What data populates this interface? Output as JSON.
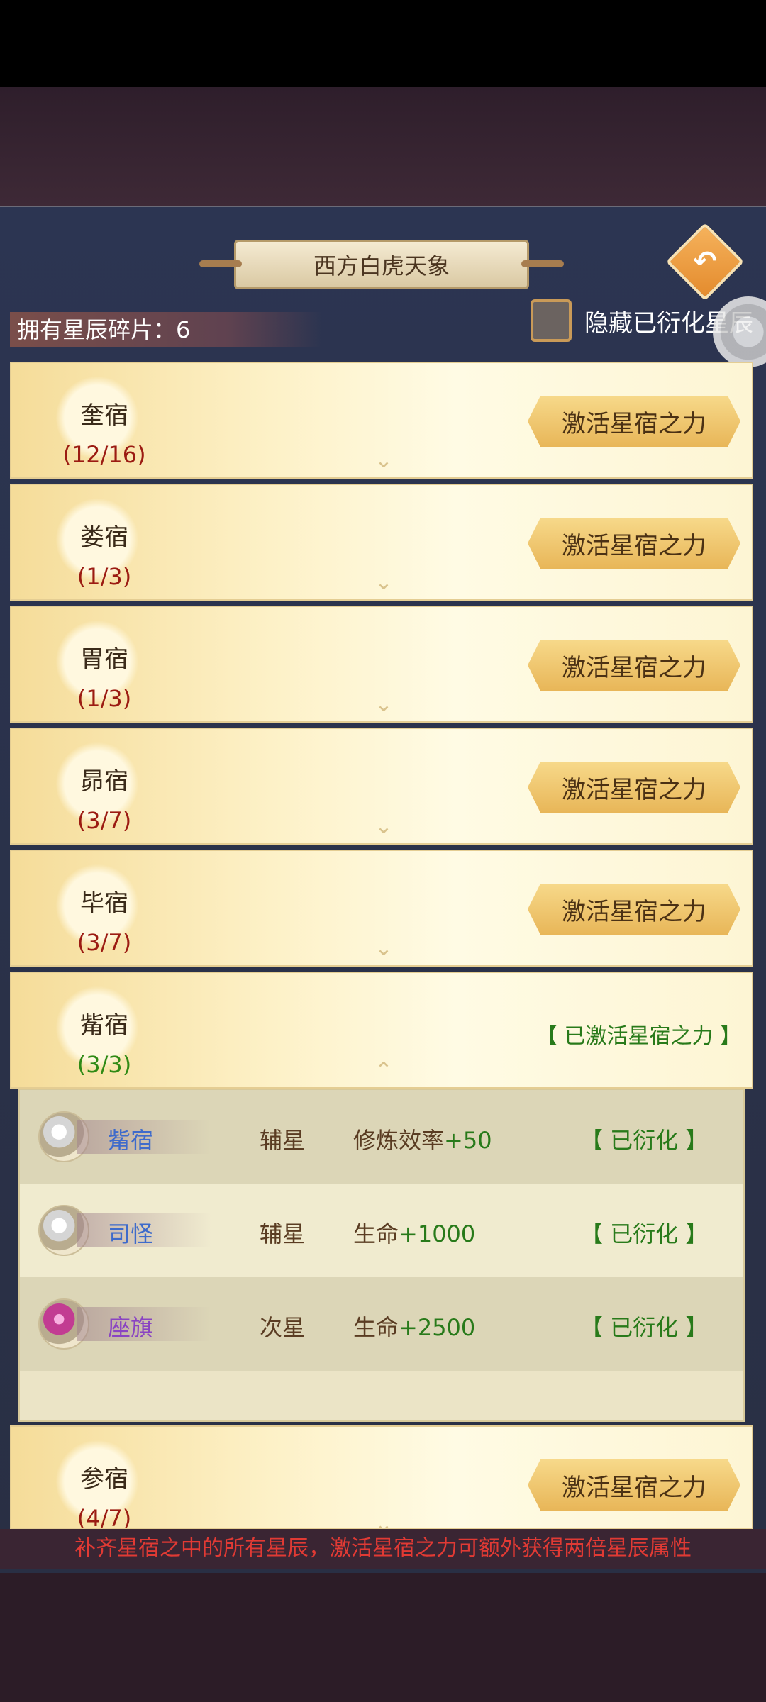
{
  "header": {
    "title": "西方白虎天象",
    "back_icon": "back-arrow-icon"
  },
  "shards": {
    "label": "拥有星辰碎片：6"
  },
  "hide_option": {
    "label": "隐藏已衍化星辰",
    "checked": false
  },
  "rows": [
    {
      "name": "奎宿",
      "progress": "(12/16)",
      "button": "激活星宿之力"
    },
    {
      "name": "娄宿",
      "progress": "(1/3)",
      "button": "激活星宿之力"
    },
    {
      "name": "胃宿",
      "progress": "(1/3)",
      "button": "激活星宿之力"
    },
    {
      "name": "昴宿",
      "progress": "(3/7)",
      "button": "激活星宿之力"
    },
    {
      "name": "毕宿",
      "progress": "(3/7)",
      "button": "激活星宿之力"
    },
    {
      "name": "觜宿",
      "progress": "(3/3)",
      "status": "【 已激活星宿之力 】"
    },
    {
      "name": "参宿",
      "progress": "(4/7)",
      "button": "激活星宿之力"
    }
  ],
  "stars": [
    {
      "name": "觜宿",
      "type": "辅星",
      "effect_label": "修炼效率",
      "effect_value": "+50",
      "status": "【 已衍化 】"
    },
    {
      "name": "司怪",
      "type": "辅星",
      "effect_label": "生命",
      "effect_value": "+1000",
      "status": "【 已衍化 】"
    },
    {
      "name": "座旗",
      "type": "次星",
      "effect_label": "生命",
      "effect_value": "+2500",
      "status": "【 已衍化 】"
    }
  ],
  "footer": {
    "message": "补齐星宿之中的所有星辰，激活星宿之力可额外获得两倍星辰属性"
  }
}
